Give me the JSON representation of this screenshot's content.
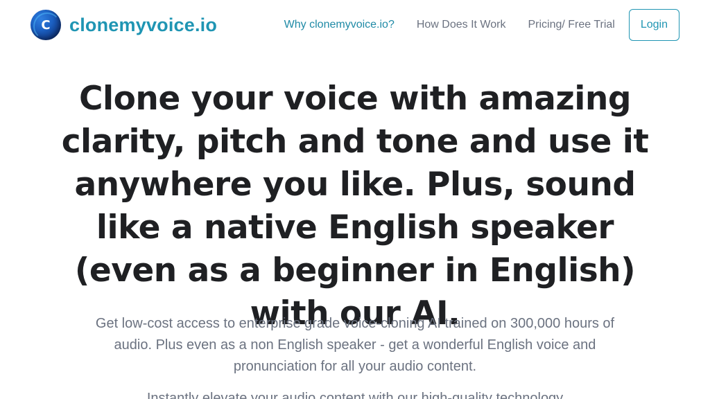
{
  "header": {
    "logo_letter": "C",
    "logo_text": "clonemyvoice.io",
    "nav": {
      "why": "Why clonemyvoice.io?",
      "how": "How Does It Work",
      "pricing": "Pricing/ Free Trial"
    },
    "login_label": "Login"
  },
  "hero": {
    "title": "Clone your voice with amazing clarity, pitch and tone and use it anywhere you like. Plus, sound like a native English speaker (even as a beginner in English) with our AI.",
    "subtitle": "Get low-cost access to enterprise grade voice-cloning AI trained on 300,000 hours of audio. Plus even as a non English speaker - get a wonderful English voice and pronunciation for all your audio content.",
    "more_text": "Instantly elevate your audio content with our high-quality technology"
  },
  "colors": {
    "brand": "#1f95b3",
    "nav_active": "#1f8aa6",
    "heading": "#1f2023",
    "muted_text": "#6b7280",
    "logo_dark": "#0e2f74"
  },
  "icons": {
    "logo": "clonemyvoice-logo-icon"
  }
}
